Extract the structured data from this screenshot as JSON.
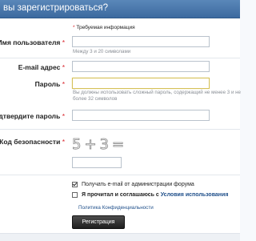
{
  "header": {
    "title": "вы зарегистрироваться?"
  },
  "required_note": {
    "star": "*",
    "text": "Требуемая информация"
  },
  "fields": {
    "username": {
      "label": "Имя пользователя",
      "star": "*",
      "value": "",
      "hint": "Между 3 и 20 символами"
    },
    "email": {
      "label": "E-mail адрес",
      "star": "*",
      "value": ""
    },
    "password": {
      "label": "Пароль",
      "star": "*",
      "value": "",
      "hint_line1": "Вы должны использовать сложный пароль, содержащий не менее 3 и не",
      "hint_line2": "более 32 символов"
    },
    "confirm": {
      "label": "Подтвердите пароль",
      "star": "*",
      "value": ""
    },
    "captcha": {
      "label": "Код безопасности",
      "star": "*",
      "image_text": "5+3=",
      "value": ""
    }
  },
  "options": {
    "admin_email": {
      "label": "Получать e-mail от администрации форума",
      "checked": true
    },
    "terms": {
      "label_prefix": "Я прочитал и соглашаюсь с ",
      "label_link": "Условия использования",
      "checked": false
    },
    "policy_link": "Политика Конфиденциальности"
  },
  "submit": {
    "label": "Регистрация"
  },
  "colors": {
    "header": "#3c6a9f",
    "required": "#d8232a",
    "link": "#1f4f8a"
  }
}
